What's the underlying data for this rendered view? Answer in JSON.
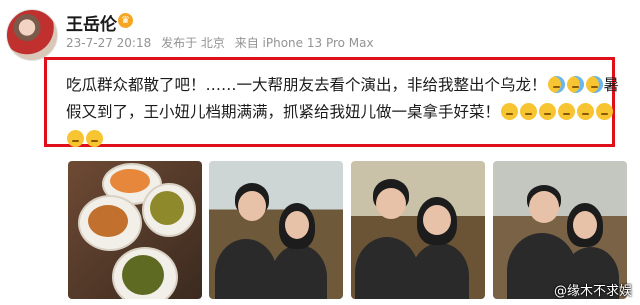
{
  "user": {
    "name": "王岳伦",
    "badge_icon": "vip-crown-icon"
  },
  "meta": {
    "time": "23-7-27 20:18",
    "location": "发布于 北京",
    "device": "来自 iPhone 13 Pro Max"
  },
  "post": {
    "line1": "吃瓜群众都散了吧！……一大帮朋友去看个演出，非给我整出个乌龙！",
    "line1_end": "暑",
    "line2": "假又到了，王小妞儿档期满满，抓紧给我妞儿做一桌拿手好菜！"
  },
  "highlight_color": "#e0101a",
  "watermark": "@缘木不求娱"
}
